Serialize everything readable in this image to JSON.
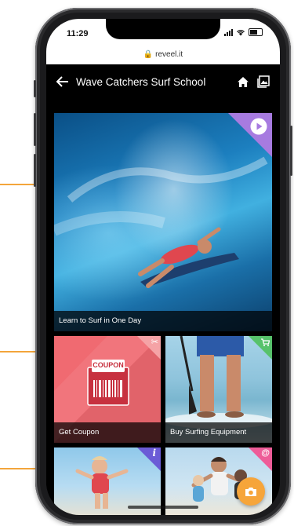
{
  "status_bar": {
    "time": "11:29"
  },
  "browser": {
    "url": "reveel.it"
  },
  "app_bar": {
    "title": "Wave Catchers Surf School"
  },
  "tiles": [
    {
      "caption": "Learn to Surf in One Day",
      "badge_icon": "play-icon",
      "badge_color": "#a77be0"
    },
    {
      "caption": "Get Coupon",
      "badge_icon": "scissors-icon",
      "badge_color": "#f06a71",
      "coupon_label": "COUPON"
    },
    {
      "caption": "Buy Surfing Equipment",
      "badge_icon": "cart-icon",
      "badge_color": "#57c26b"
    },
    {
      "caption": "",
      "badge_icon": "info-icon",
      "badge_color": "#6b5bd6"
    },
    {
      "caption": "",
      "badge_icon": "at-icon",
      "badge_color": "#ee5c98"
    }
  ],
  "fab": {
    "icon": "camera-icon"
  },
  "colors": {
    "accent": "#f3a53b"
  }
}
